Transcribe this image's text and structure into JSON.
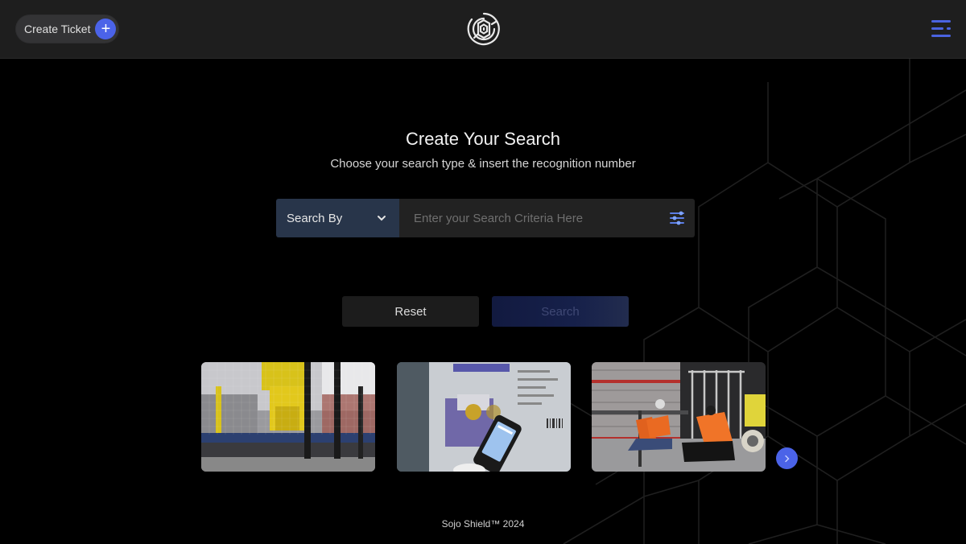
{
  "header": {
    "create_ticket_label": "Create Ticket",
    "create_ticket_icon": "plus-icon",
    "logo_icon": "shield-logo-icon",
    "menu_icon": "hamburger-menu-icon",
    "accent_color": "#4b63e8"
  },
  "main": {
    "title": "Create Your Search",
    "subtitle": "Choose your search type & insert the recognition number",
    "search": {
      "search_by_label": "Search By",
      "search_by_icon": "chevron-down-icon",
      "input_value": "",
      "input_placeholder": "Enter your Search Criteria Here",
      "filter_icon": "sliders-icon"
    },
    "buttons": {
      "reset_label": "Reset",
      "search_label": "Search"
    },
    "carousel": {
      "items": [
        {
          "alt": "Yellow industrial robot arm behind safety cage"
        },
        {
          "alt": "Handheld barcode scanner reading a package label"
        },
        {
          "alt": "Warehouse workers in safety vests beside forklift"
        }
      ],
      "next_icon": "chevron-right-icon"
    }
  },
  "footer": {
    "text": "Sojo Shield™ 2024"
  }
}
